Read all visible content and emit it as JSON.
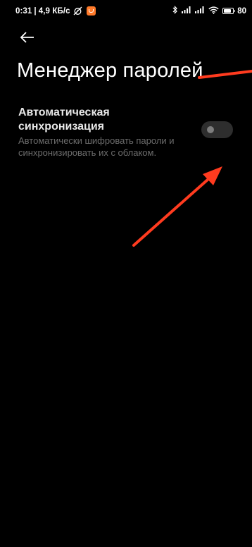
{
  "status_bar": {
    "time": "0:31",
    "separator": "|",
    "speed": "4,9 КБ/с",
    "battery": "80",
    "battery_level_percent": 80
  },
  "header": {
    "back_icon": "arrow-left-icon",
    "title": "Менеджер паролей"
  },
  "setting": {
    "title": "Автоматическая синхронизация",
    "description": "Автоматически шифровать пароли и синхронизировать их с облаком.",
    "toggle_on": false
  },
  "annotations": {
    "color": "#ff3b1f"
  },
  "colors": {
    "background": "#000000",
    "title_text": "#ffffff",
    "desc_text": "#6c6c6c",
    "toggle_track": "#2e2e2e",
    "toggle_knob": "#7d7d7d"
  }
}
